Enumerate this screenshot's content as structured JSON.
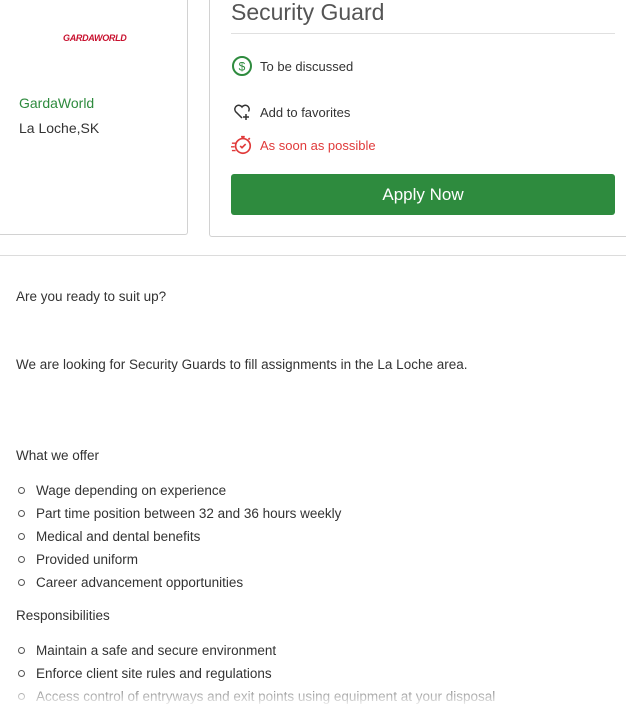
{
  "company": {
    "logo_text": "GARDAWORLD",
    "name": "GardaWorld",
    "location": "La Loche,SK"
  },
  "job": {
    "title": "Security Guard",
    "salary": "To be discussed",
    "favorites": "Add to favorites",
    "start": "As soon as possible",
    "apply_label": "Apply Now"
  },
  "description": {
    "intro": "Are you ready to suit up?",
    "looking": "We are looking for Security Guards to fill assignments in the La Loche area.",
    "offer_heading": "What we offer",
    "offer_items": [
      "Wage depending on experience",
      "Part time position between 32 and 36 hours weekly",
      "Medical and dental benefits",
      "Provided uniform",
      "Career advancement opportunities"
    ],
    "resp_heading": "Responsibilities",
    "resp_items": [
      "Maintain a safe and secure environment",
      "Enforce client site rules and regulations",
      "Access control of entryways and exit points using equipment at your disposal"
    ]
  },
  "colors": {
    "brand_green": "#2e8b3e",
    "alert_red": "#e03a3a",
    "logo_red": "#c8102e"
  },
  "icons": {
    "salary": "dollar-circle-icon",
    "favorites": "heart-plus-icon",
    "start": "stopwatch-icon"
  }
}
